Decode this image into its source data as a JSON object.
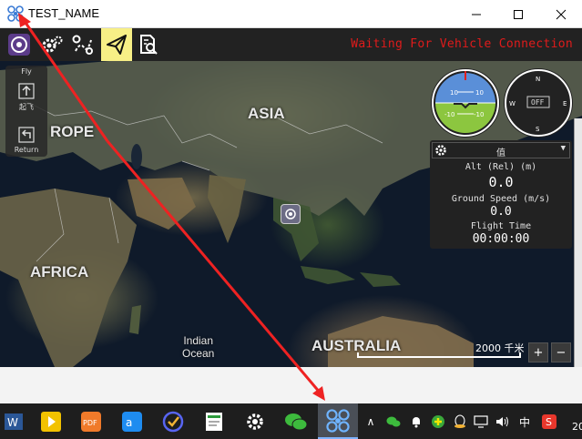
{
  "window": {
    "title": "TEST_NAME",
    "controls": [
      "minimize",
      "maximize",
      "close"
    ]
  },
  "toolbar": {
    "buttons": [
      {
        "name": "app-logo",
        "active": false
      },
      {
        "name": "vehicle-setup",
        "active": false
      },
      {
        "name": "plan-view",
        "active": false
      },
      {
        "name": "fly-view",
        "active": true
      },
      {
        "name": "analyze",
        "active": false
      }
    ],
    "status": "Waiting For Vehicle Connection",
    "status_color": "#e01b1b",
    "active_color": "#f7ef86"
  },
  "fly_panel": {
    "fly_label": "Fly",
    "takeoff_label": "起飞",
    "return_label": "Return"
  },
  "map": {
    "labels": {
      "asia": "ASIA",
      "europe": "ROPE",
      "africa": "AFRICA",
      "australia": "AUSTRALIA",
      "ocean_line1": "Indian",
      "ocean_line2": "Ocean"
    },
    "scale_text": "2000 千米",
    "zoom_in": "+",
    "zoom_out": "−"
  },
  "instruments": {
    "attitude": {
      "pitch_up": "10",
      "pitch_up2": "10",
      "pitch_down": "-10",
      "pitch_down2": "-10"
    },
    "compass": {
      "n": "N",
      "e": "E",
      "s": "S",
      "w": "W",
      "off": "OFF"
    }
  },
  "values_panel": {
    "title": "值",
    "alt_label": "Alt (Rel) (m)",
    "alt_value": "0.0",
    "speed_label": "Ground Speed (m/s)",
    "speed_value": "0.0",
    "time_label": "Flight Time",
    "time_value": "00:00:00"
  },
  "taskbar": {
    "apps": [
      "word-icon",
      "player-icon",
      "pdf-icon",
      "dingtalk-icon",
      "tasks-icon",
      "notes-icon",
      "settings-icon",
      "wechat-icon",
      "qgc-icon"
    ],
    "active_app": "qgc-icon",
    "tray": {
      "ime": "中",
      "clock_partial": "20"
    }
  }
}
